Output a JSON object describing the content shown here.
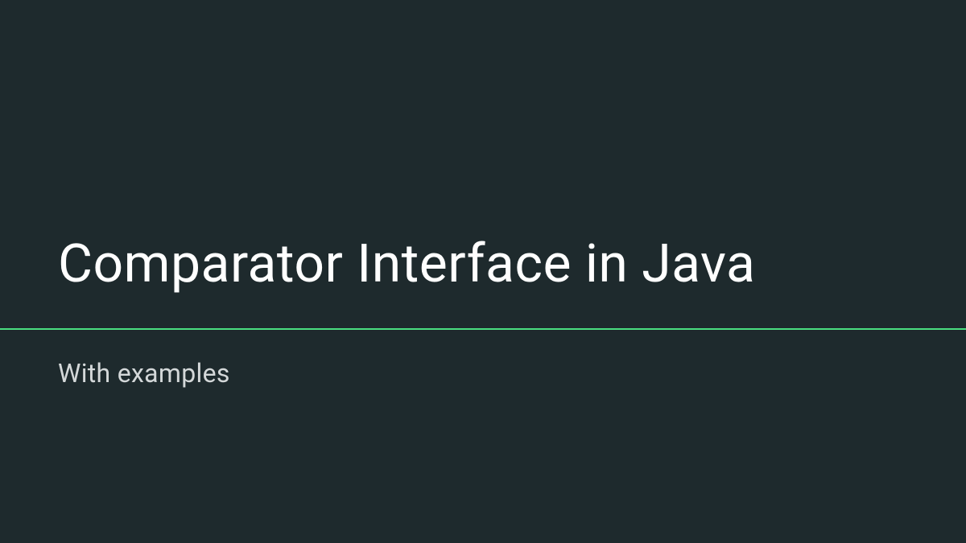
{
  "slide": {
    "title": "Comparator Interface in Java",
    "subtitle": "With examples",
    "colors": {
      "background": "#1e2a2d",
      "title_text": "#ffffff",
      "subtitle_text": "#d4d8d9",
      "divider": "#4ade80"
    }
  }
}
